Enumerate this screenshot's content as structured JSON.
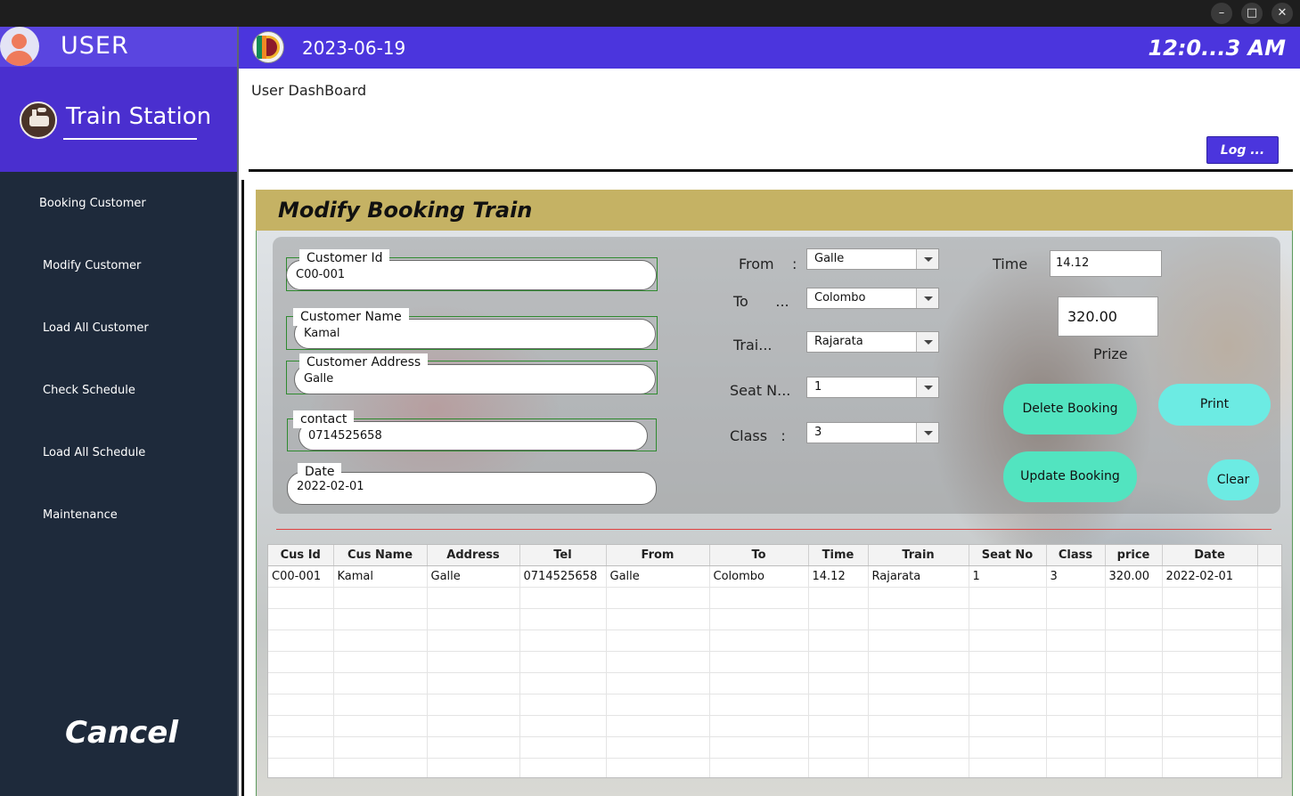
{
  "window": {
    "controls": {
      "minimize": "–",
      "maximize": "□",
      "close": "✕"
    }
  },
  "sidebar": {
    "user_label": "USER",
    "brand_title": "Train Station",
    "menu": [
      {
        "label": "Booking Customer"
      },
      {
        "label": "Modify Customer"
      },
      {
        "label": "Load All Customer"
      },
      {
        "label": "Check Schedule"
      },
      {
        "label": "Load All Schedule"
      },
      {
        "label": "Maintenance"
      }
    ],
    "cancel_label": "Cancel"
  },
  "header": {
    "date": "2023-06-19",
    "time": "12:0...3 AM",
    "page_title": "User DashBoard",
    "logout_label": "Log ..."
  },
  "panel": {
    "title": "Modify Booking Train"
  },
  "form": {
    "customer_id": {
      "label": "Customer Id",
      "value": "C00-001"
    },
    "customer_name": {
      "label": "Customer Name",
      "value": "Kamal"
    },
    "customer_address": {
      "label": "Customer Address",
      "value": "Galle"
    },
    "contact": {
      "label": "contact",
      "value": "0714525658"
    },
    "date": {
      "label": "Date",
      "value": "2022-02-01"
    },
    "from": {
      "label": "From    :",
      "value": "Galle"
    },
    "to": {
      "label": "To      ...",
      "value": "Colombo"
    },
    "train": {
      "label": "Trai...",
      "value": "Rajarata"
    },
    "seat_no": {
      "label": "Seat N...",
      "value": "1"
    },
    "class": {
      "label": "Class   :",
      "value": "3"
    },
    "time": {
      "label": "Time     :",
      "value": "14.12"
    },
    "prize": {
      "label": "Prize",
      "value": "320.00"
    }
  },
  "buttons": {
    "delete": "Delete Booking",
    "update": "Update Booking",
    "print": "Print",
    "clear": "Clear"
  },
  "table": {
    "columns": [
      "Cus Id",
      "Cus Name",
      "Address",
      "Tel",
      "From",
      "To",
      "Time",
      "Train",
      "Seat No",
      "Class",
      "price",
      "Date",
      ""
    ],
    "rows": [
      [
        "C00-001",
        "Kamal",
        "Galle",
        "0714525658",
        "Galle",
        "Colombo",
        "14.12",
        "Rajarata",
        "1",
        "3",
        "320.00",
        "2022-02-01",
        ""
      ]
    ],
    "empty_rows": 9
  }
}
